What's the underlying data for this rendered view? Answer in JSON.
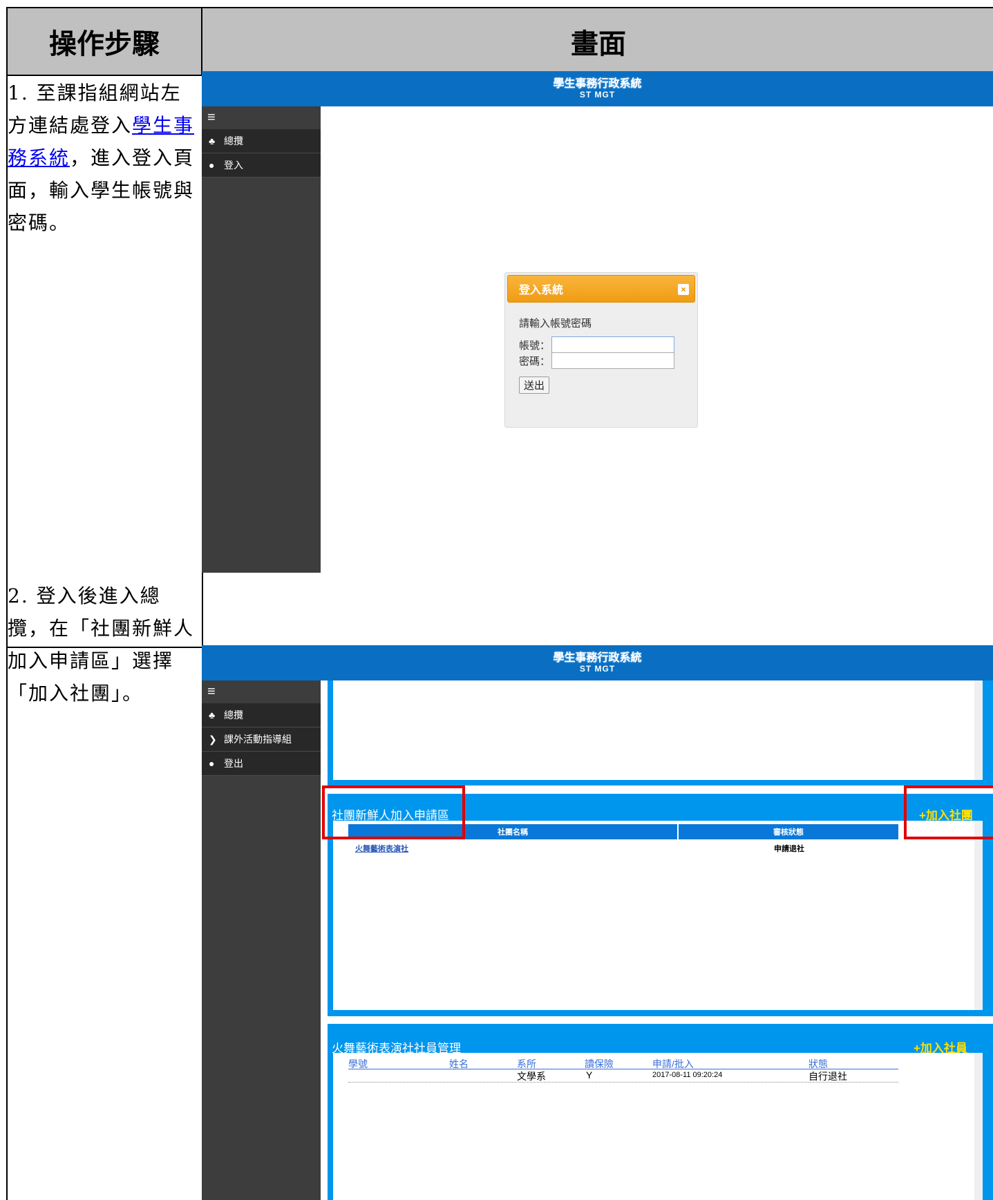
{
  "doc": {
    "header_left": "操作步驟",
    "header_right": "畫面"
  },
  "step1": {
    "text_before": "1. 至課指組網站左方連結處登入",
    "link": "學生事務系統",
    "text_after": "，進入登入頁面，輸入學生帳號與密碼。"
  },
  "step2": {
    "text": "2. 登入後進入總攬，在「社團新鮮人加入申請區」選擇「加入社團」。"
  },
  "app": {
    "title": "學生事務行政系統",
    "subtitle": "ST MGT"
  },
  "shot1": {
    "menu": [
      {
        "icon": "sitemap-icon",
        "label": "總攬"
      },
      {
        "icon": "users-icon",
        "label": "登入"
      }
    ],
    "dialog": {
      "title": "登入系統",
      "close": "×",
      "prompt": "請輸入帳號密碼",
      "account_label": "帳號：",
      "password_label": "密碼：",
      "account_value": "",
      "password_value": "",
      "submit": "送出"
    }
  },
  "shot2": {
    "menu": [
      {
        "icon": "sitemap-icon",
        "label": "總攬"
      },
      {
        "icon": "chevron-right-icon",
        "label": "課外活動指導組"
      },
      {
        "icon": "users-icon",
        "label": "登出"
      }
    ],
    "freshman": {
      "title": "社團新鮮人加入申請區",
      "add_link": "+加入社團",
      "columns": [
        "社團名稱",
        "審核狀態"
      ],
      "rows": [
        {
          "club": "火舞藝術表演社",
          "status": "申請退社"
        }
      ]
    },
    "members": {
      "title": "火舞藝術表演社社員管理",
      "add_link": "+加入社員",
      "columns": [
        "學號",
        "姓名",
        "系所",
        "讀保險",
        "申請/批入",
        "狀態"
      ],
      "rows": [
        {
          "id": "",
          "name": "",
          "dept": "文學系",
          "insurance": "Y",
          "date": "2017-08-11 09:20:24",
          "status": "自行退社"
        }
      ]
    }
  },
  "colors": {
    "topbar": "#0a6fc2",
    "sidebar": "#3d3d3d",
    "panel_blue": "#0096ee",
    "dialog_header": "#f5a623",
    "highlight": "#e00000",
    "add_link": "#ffe000"
  }
}
